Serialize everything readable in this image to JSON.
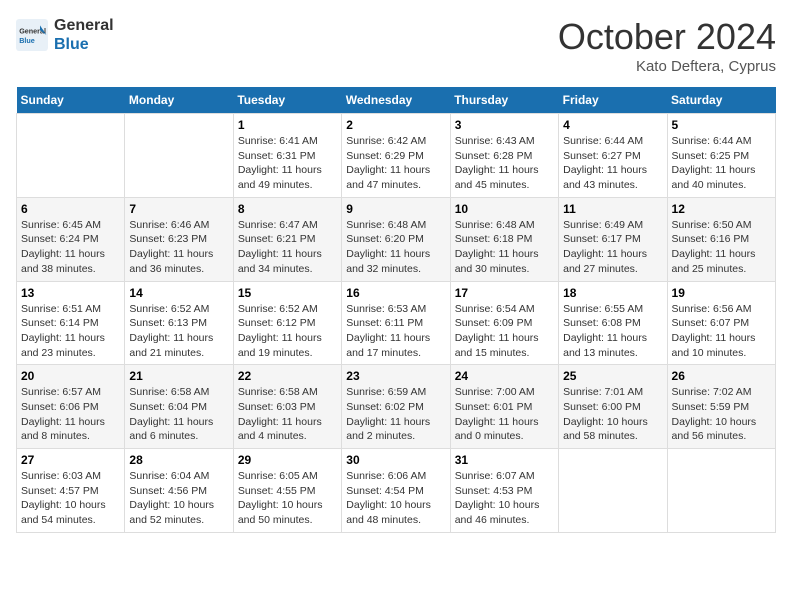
{
  "header": {
    "logo_line1": "General",
    "logo_line2": "Blue",
    "month": "October 2024",
    "location": "Kato Deftera, Cyprus"
  },
  "days_of_week": [
    "Sunday",
    "Monday",
    "Tuesday",
    "Wednesday",
    "Thursday",
    "Friday",
    "Saturday"
  ],
  "weeks": [
    [
      {
        "day": "",
        "text": ""
      },
      {
        "day": "",
        "text": ""
      },
      {
        "day": "1",
        "text": "Sunrise: 6:41 AM\nSunset: 6:31 PM\nDaylight: 11 hours and 49 minutes."
      },
      {
        "day": "2",
        "text": "Sunrise: 6:42 AM\nSunset: 6:29 PM\nDaylight: 11 hours and 47 minutes."
      },
      {
        "day": "3",
        "text": "Sunrise: 6:43 AM\nSunset: 6:28 PM\nDaylight: 11 hours and 45 minutes."
      },
      {
        "day": "4",
        "text": "Sunrise: 6:44 AM\nSunset: 6:27 PM\nDaylight: 11 hours and 43 minutes."
      },
      {
        "day": "5",
        "text": "Sunrise: 6:44 AM\nSunset: 6:25 PM\nDaylight: 11 hours and 40 minutes."
      }
    ],
    [
      {
        "day": "6",
        "text": "Sunrise: 6:45 AM\nSunset: 6:24 PM\nDaylight: 11 hours and 38 minutes."
      },
      {
        "day": "7",
        "text": "Sunrise: 6:46 AM\nSunset: 6:23 PM\nDaylight: 11 hours and 36 minutes."
      },
      {
        "day": "8",
        "text": "Sunrise: 6:47 AM\nSunset: 6:21 PM\nDaylight: 11 hours and 34 minutes."
      },
      {
        "day": "9",
        "text": "Sunrise: 6:48 AM\nSunset: 6:20 PM\nDaylight: 11 hours and 32 minutes."
      },
      {
        "day": "10",
        "text": "Sunrise: 6:48 AM\nSunset: 6:18 PM\nDaylight: 11 hours and 30 minutes."
      },
      {
        "day": "11",
        "text": "Sunrise: 6:49 AM\nSunset: 6:17 PM\nDaylight: 11 hours and 27 minutes."
      },
      {
        "day": "12",
        "text": "Sunrise: 6:50 AM\nSunset: 6:16 PM\nDaylight: 11 hours and 25 minutes."
      }
    ],
    [
      {
        "day": "13",
        "text": "Sunrise: 6:51 AM\nSunset: 6:14 PM\nDaylight: 11 hours and 23 minutes."
      },
      {
        "day": "14",
        "text": "Sunrise: 6:52 AM\nSunset: 6:13 PM\nDaylight: 11 hours and 21 minutes."
      },
      {
        "day": "15",
        "text": "Sunrise: 6:52 AM\nSunset: 6:12 PM\nDaylight: 11 hours and 19 minutes."
      },
      {
        "day": "16",
        "text": "Sunrise: 6:53 AM\nSunset: 6:11 PM\nDaylight: 11 hours and 17 minutes."
      },
      {
        "day": "17",
        "text": "Sunrise: 6:54 AM\nSunset: 6:09 PM\nDaylight: 11 hours and 15 minutes."
      },
      {
        "day": "18",
        "text": "Sunrise: 6:55 AM\nSunset: 6:08 PM\nDaylight: 11 hours and 13 minutes."
      },
      {
        "day": "19",
        "text": "Sunrise: 6:56 AM\nSunset: 6:07 PM\nDaylight: 11 hours and 10 minutes."
      }
    ],
    [
      {
        "day": "20",
        "text": "Sunrise: 6:57 AM\nSunset: 6:06 PM\nDaylight: 11 hours and 8 minutes."
      },
      {
        "day": "21",
        "text": "Sunrise: 6:58 AM\nSunset: 6:04 PM\nDaylight: 11 hours and 6 minutes."
      },
      {
        "day": "22",
        "text": "Sunrise: 6:58 AM\nSunset: 6:03 PM\nDaylight: 11 hours and 4 minutes."
      },
      {
        "day": "23",
        "text": "Sunrise: 6:59 AM\nSunset: 6:02 PM\nDaylight: 11 hours and 2 minutes."
      },
      {
        "day": "24",
        "text": "Sunrise: 7:00 AM\nSunset: 6:01 PM\nDaylight: 11 hours and 0 minutes."
      },
      {
        "day": "25",
        "text": "Sunrise: 7:01 AM\nSunset: 6:00 PM\nDaylight: 10 hours and 58 minutes."
      },
      {
        "day": "26",
        "text": "Sunrise: 7:02 AM\nSunset: 5:59 PM\nDaylight: 10 hours and 56 minutes."
      }
    ],
    [
      {
        "day": "27",
        "text": "Sunrise: 6:03 AM\nSunset: 4:57 PM\nDaylight: 10 hours and 54 minutes."
      },
      {
        "day": "28",
        "text": "Sunrise: 6:04 AM\nSunset: 4:56 PM\nDaylight: 10 hours and 52 minutes."
      },
      {
        "day": "29",
        "text": "Sunrise: 6:05 AM\nSunset: 4:55 PM\nDaylight: 10 hours and 50 minutes."
      },
      {
        "day": "30",
        "text": "Sunrise: 6:06 AM\nSunset: 4:54 PM\nDaylight: 10 hours and 48 minutes."
      },
      {
        "day": "31",
        "text": "Sunrise: 6:07 AM\nSunset: 4:53 PM\nDaylight: 10 hours and 46 minutes."
      },
      {
        "day": "",
        "text": ""
      },
      {
        "day": "",
        "text": ""
      }
    ]
  ]
}
